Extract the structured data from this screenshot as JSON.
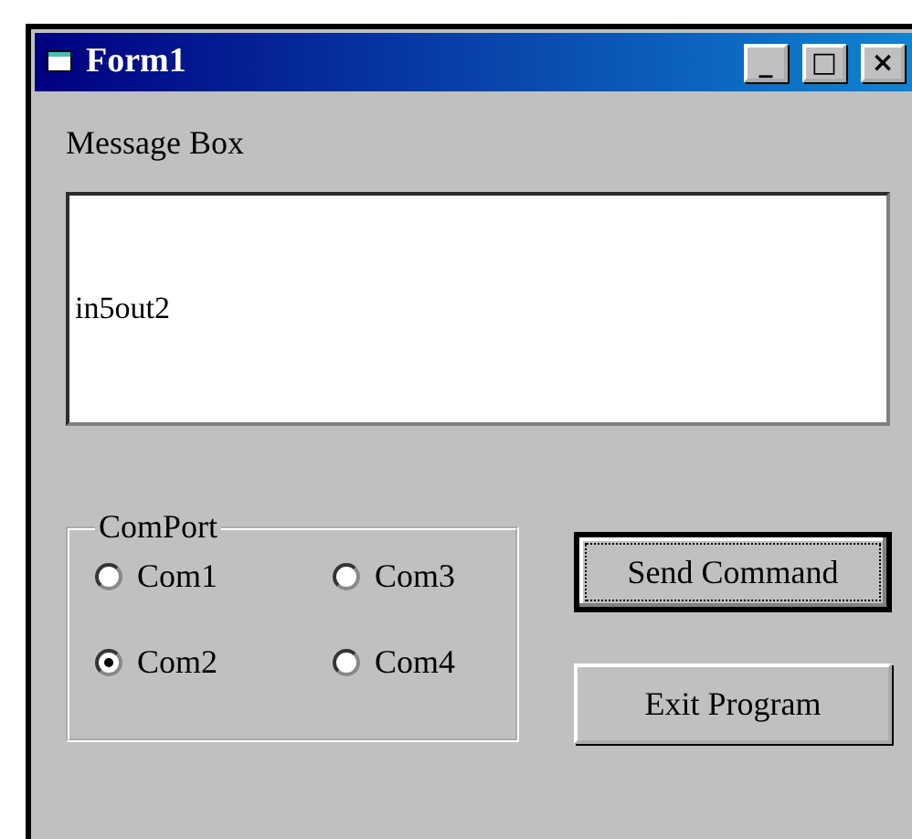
{
  "window": {
    "title": "Form1",
    "controls": [
      "_",
      "□",
      "×"
    ]
  },
  "message_label": "Message Box",
  "message_box": {
    "value": "in5out2"
  },
  "comport": {
    "title": "ComPort",
    "options": [
      {
        "label": "Com1",
        "selected": false
      },
      {
        "label": "Com3",
        "selected": false
      },
      {
        "label": "Com2",
        "selected": true
      },
      {
        "label": "Com4",
        "selected": false
      }
    ]
  },
  "buttons": [
    {
      "label": "Send Command",
      "focused": true
    },
    {
      "label": "Exit Program",
      "focused": false
    }
  ]
}
